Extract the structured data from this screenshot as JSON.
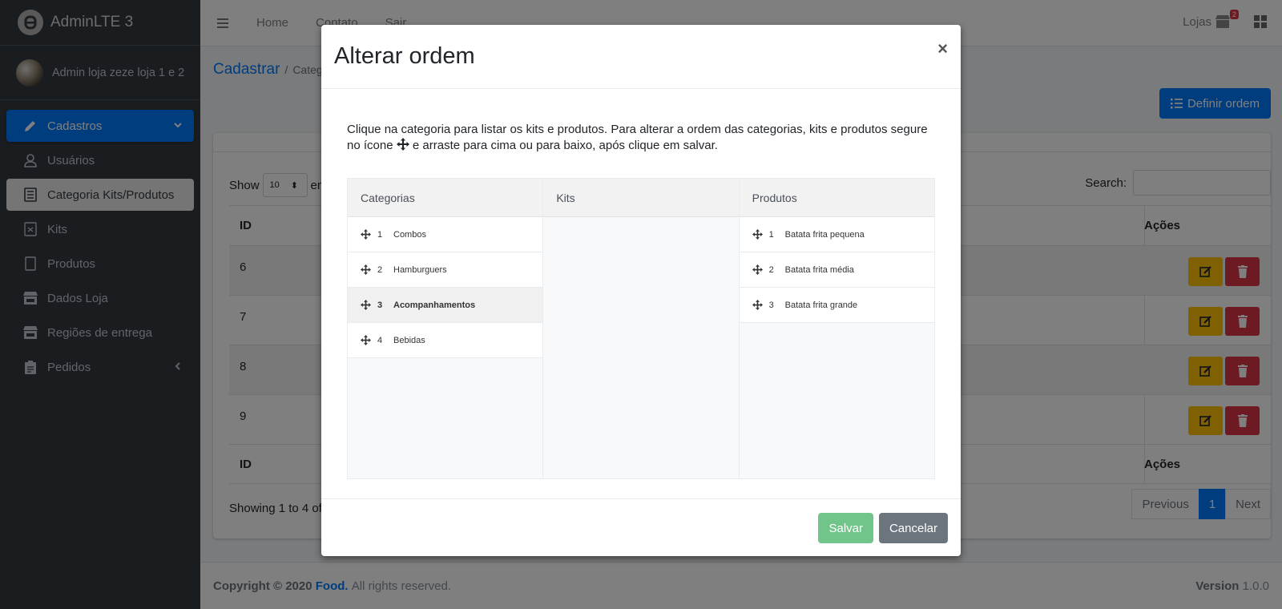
{
  "brand": {
    "title": "AdminLTE 3"
  },
  "user": {
    "name": "Admin loja zeze loja 1 e 2"
  },
  "sidebar": {
    "items": [
      {
        "label": "Cadastros"
      },
      {
        "label": "Usuários"
      },
      {
        "label": "Categoria Kits/Produtos"
      },
      {
        "label": "Kits"
      },
      {
        "label": "Produtos"
      },
      {
        "label": "Dados Loja"
      },
      {
        "label": "Regiões de entrega"
      },
      {
        "label": "Pedidos"
      }
    ]
  },
  "topbar": {
    "links": [
      "Home",
      "Contato",
      "Sair"
    ],
    "stores_label": "Lojas",
    "stores_badge": "2"
  },
  "breadcrumb": {
    "root": "Cadastrar",
    "sep": "/",
    "current": "Categ"
  },
  "page": {
    "define_order_label": "Definir ordem"
  },
  "table": {
    "show_label": "Show",
    "show_suffix": "en",
    "page_size": "10",
    "search_label": "Search:",
    "col_id": "ID",
    "col_actions": "Ações",
    "rows": [
      "6",
      "7",
      "8",
      "9"
    ],
    "showing": "Showing 1 to 4 of"
  },
  "pagination": {
    "previous": "Previous",
    "page": "1",
    "next": "Next"
  },
  "footer": {
    "copyright": "Copyright © 2020",
    "brand": "Food.",
    "rights": "All rights reserved.",
    "version_label": "Version",
    "version": "1.0.0"
  },
  "modal": {
    "title": "Alterar ordem",
    "close": "×",
    "description_1": "Clique na categoria para listar os kits e produtos. Para alterar a ordem das categorias, kits e produtos segure no ícone",
    "description_2": "e arraste para cima ou para baixo, após clique em salvar.",
    "columns": {
      "categories": "Categorias",
      "kits": "Kits",
      "products": "Produtos"
    },
    "categories": [
      {
        "n": "1",
        "label": "Combos"
      },
      {
        "n": "2",
        "label": "Hamburguers"
      },
      {
        "n": "3",
        "label": "Acompanhamentos"
      },
      {
        "n": "4",
        "label": "Bebidas"
      }
    ],
    "products": [
      {
        "n": "1",
        "label": "Batata frita pequena"
      },
      {
        "n": "2",
        "label": "Batata frita média"
      },
      {
        "n": "3",
        "label": "Batata frita grande"
      }
    ],
    "save": "Salvar",
    "cancel": "Cancelar"
  },
  "colors": {
    "primary": "#007bff",
    "warning": "#ffc107",
    "danger": "#dc3545",
    "sidebar": "#343a40",
    "save": "#72c58a",
    "cancel": "#6c757d"
  }
}
